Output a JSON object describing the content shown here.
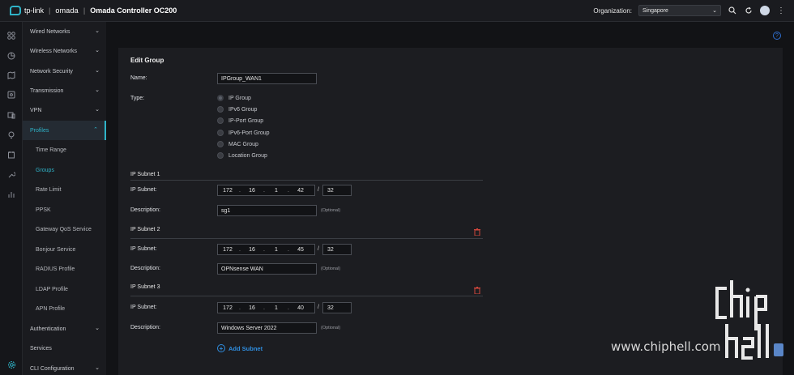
{
  "header": {
    "brand_tplink": "tp-link",
    "brand_omada": "omada",
    "product": "Omada Controller OC200",
    "org_label": "Organization:",
    "org_value": "Singapore"
  },
  "sidebar": {
    "items": [
      {
        "label": "Wired Networks",
        "chev": "⌄"
      },
      {
        "label": "Wireless Networks",
        "chev": "⌄"
      },
      {
        "label": "Network Security",
        "chev": "⌄"
      },
      {
        "label": "Transmission",
        "chev": "⌄"
      },
      {
        "label": "VPN",
        "chev": "⌄"
      },
      {
        "label": "Profiles",
        "chev": "⌃"
      },
      {
        "label": "Time Range"
      },
      {
        "label": "Groups"
      },
      {
        "label": "Rate Limit"
      },
      {
        "label": "PPSK"
      },
      {
        "label": "Gateway QoS Service"
      },
      {
        "label": "Bonjour Service"
      },
      {
        "label": "RADIUS Profile"
      },
      {
        "label": "LDAP Profile"
      },
      {
        "label": "APN Profile"
      },
      {
        "label": "Authentication",
        "chev": "⌄"
      },
      {
        "label": "Services"
      },
      {
        "label": "CLI Configuration",
        "chev": "⌄"
      }
    ]
  },
  "form": {
    "title": "Edit Group",
    "name_label": "Name:",
    "name_value": "IPGroup_WAN1",
    "type_label": "Type:",
    "types": [
      "IP Group",
      "IPv6 Group",
      "IP-Port Group",
      "IPv6-Port Group",
      "MAC Group",
      "Location Group"
    ],
    "selected_type": "IP Group",
    "subnet_label": "IP Subnet:",
    "description_label": "Description:",
    "optional": "(Optional)",
    "subnets": [
      {
        "heading": "IP Subnet 1",
        "octets": [
          "172",
          "16",
          "1",
          "42"
        ],
        "mask": "32",
        "description": "sg1"
      },
      {
        "heading": "IP Subnet 2",
        "octets": [
          "172",
          "16",
          "1",
          "45"
        ],
        "mask": "32",
        "description": "OPNsense  WAN"
      },
      {
        "heading": "IP Subnet 3",
        "octets": [
          "172",
          "16",
          "1",
          "40"
        ],
        "mask": "32",
        "description": "Windows Server 2022"
      }
    ],
    "add_subnet": "Add Subnet"
  },
  "help_icon": "?",
  "watermark": {
    "text": "www.chiphell.com"
  },
  "colors": {
    "accent": "#2fb3c8",
    "link": "#2f8ee0",
    "danger": "#d0463c"
  }
}
